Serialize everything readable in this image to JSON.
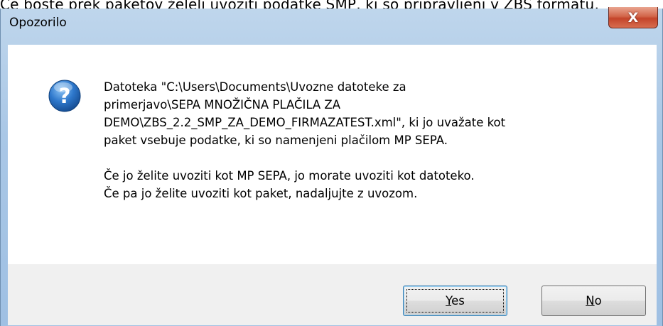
{
  "background_text": "Če boste prek paketov želeli uvoziti podatke SMP, ki so pripravljeni v ZBS formatu,",
  "window": {
    "title": "Opozorilo",
    "close_glyph": "X"
  },
  "message": {
    "icon": "question-icon",
    "lines1": [
      "Datoteka \"C:\\Users\\Documents\\Uvozne datoteke za",
      "primerjavo\\SEPA MNOŽIČNA PLAČILA ZA",
      "DEMO\\ZBS_2.2_SMP_ZA_DEMO_FIRMAZATEST.xml\", ki jo uvažate kot",
      "paket vsebuje podatke, ki so namenjeni plačilom MP SEPA."
    ],
    "lines2": [
      "Če jo želite uvoziti kot MP SEPA, jo morate uvoziti kot datoteko.",
      "Če pa jo želite uvoziti kot paket, nadaljujte z uvozom."
    ]
  },
  "buttons": {
    "yes": {
      "mnemonic": "Y",
      "rest": "es"
    },
    "no": {
      "mnemonic": "N",
      "rest": "o"
    }
  },
  "colors": {
    "titlebar": "#a9c7e6",
    "close_button": "#c4442a",
    "question_icon": "#2a6fc0",
    "footer": "#f0f0f0"
  }
}
